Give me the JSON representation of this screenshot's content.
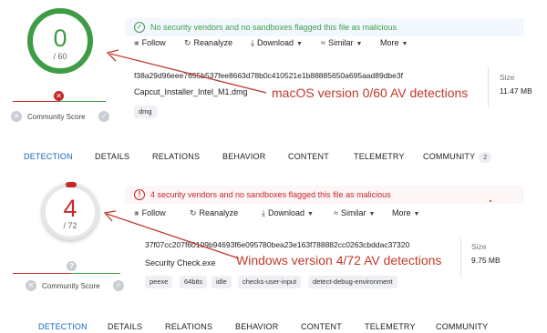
{
  "colors": {
    "clean": "#3f9b45",
    "malicious": "#c62828",
    "annotation": "#c0392b",
    "tab_active": "#1565c0"
  },
  "icons": {
    "follow": "follow-icon",
    "reanalyze": "reanalyze-icon",
    "download": "download-icon",
    "similar": "similar-icon",
    "more": "chevron-down-icon"
  },
  "mac_report": {
    "score": {
      "detections": "0",
      "total": "/ 60"
    },
    "community": {
      "label": "Community Score"
    },
    "banner": "No security vendors and no sandboxes flagged this file as malicious",
    "actions": {
      "follow": "Follow",
      "reanalyze": "Reanalyze",
      "download": "Download",
      "similar": "Similar",
      "more": "More"
    },
    "hash": "f38a29d96eee7655b537fee8663d78b0c410521e1b88885650a695aad89dbe3f",
    "filename": "Capcut_Installer_Intel_M1.dmg",
    "size": {
      "label": "Size",
      "value": "11.47 MB"
    },
    "tags": [
      "dmg"
    ],
    "annotation": "macOS version 0/60 AV detections"
  },
  "mac_tabs": [
    {
      "label": "DETECTION",
      "active": true
    },
    {
      "label": "DETAILS"
    },
    {
      "label": "RELATIONS"
    },
    {
      "label": "BEHAVIOR"
    },
    {
      "label": "CONTENT"
    },
    {
      "label": "TELEMETRY"
    },
    {
      "label": "COMMUNITY",
      "count": "2"
    }
  ],
  "win_report": {
    "score": {
      "detections": "4",
      "total": "/ 72"
    },
    "community": {
      "label": "Community Score"
    },
    "banner": "4 security vendors and no sandboxes flagged this file as malicious",
    "actions": {
      "follow": "Follow",
      "reanalyze": "Reanalyze",
      "download": "Download",
      "similar": "Similar",
      "more": "More"
    },
    "hash": "37f07cc207f60109b94693f6e095780bea23e163f788882cc0263cbddac37320",
    "filename": "Security Check.exe",
    "size": {
      "label": "Size",
      "value": "9.75 MB"
    },
    "tags": [
      "peexe",
      "64bits",
      "idle",
      "checks-user-input",
      "detect-debug-environment"
    ],
    "annotation": "Windows version 4/72 AV detections"
  },
  "win_tabs": [
    {
      "label": "DETECTION",
      "active": true
    },
    {
      "label": "DETAILS"
    },
    {
      "label": "RELATIONS"
    },
    {
      "label": "BEHAVIOR"
    },
    {
      "label": "CONTENT"
    },
    {
      "label": "TELEMETRY"
    },
    {
      "label": "COMMUNITY"
    }
  ]
}
